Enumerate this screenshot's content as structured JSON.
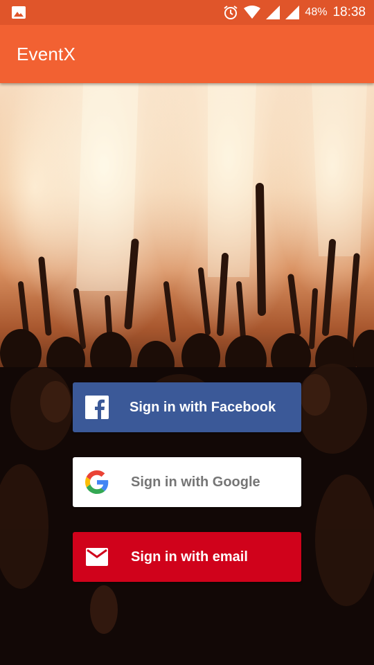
{
  "status_bar": {
    "notification_icon": "image-icon",
    "alarm_icon": "alarm-icon",
    "wifi_icon": "wifi-icon",
    "signal_icon": "signal-icon",
    "battery_percent": "48%",
    "battery_icon": "battery-icon",
    "time": "18:38"
  },
  "app_bar": {
    "title": "EventX"
  },
  "hero": {
    "image": "concert-crowd-background"
  },
  "buttons": {
    "facebook": {
      "label": "Sign in with Facebook",
      "icon": "facebook-icon",
      "color": "#3b5998"
    },
    "google": {
      "label": "Sign in with Google",
      "icon": "google-icon",
      "color": "#ffffff"
    },
    "email": {
      "label": "Sign in with email",
      "icon": "mail-icon",
      "color": "#d0021b"
    }
  },
  "colors": {
    "status_bar": "#e0552a",
    "app_bar": "#f26132"
  }
}
